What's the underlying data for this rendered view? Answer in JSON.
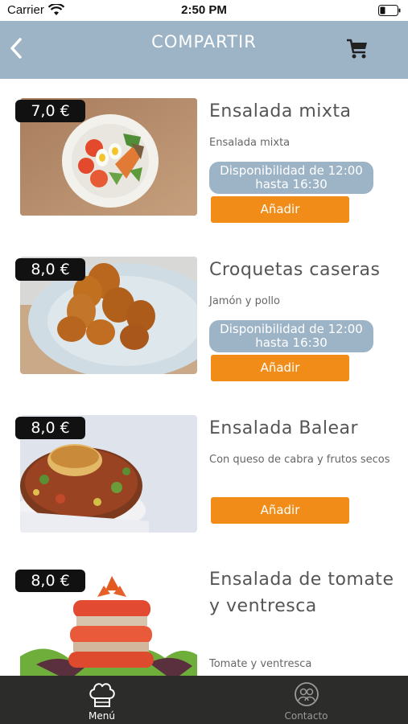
{
  "status_bar": {
    "carrier": "Carrier",
    "time": "2:50 PM"
  },
  "header": {
    "title": "COMPARTIR",
    "back_icon": "chevron-left-icon",
    "cart_icon": "shopping-cart-icon"
  },
  "colors": {
    "header": "#9db3c6",
    "accent": "#f28c18",
    "tabbar": "#2c2c2a",
    "price_badge": "#111111"
  },
  "items": [
    {
      "price": "7,0 €",
      "name": "Ensalada mixta",
      "description": "Ensalada mixta",
      "availability": "Disponibilidad de 12:00 hasta 16:30",
      "add_label": "Añadir"
    },
    {
      "price": "8,0 €",
      "name": "Croquetas caseras",
      "description": "Jamón y pollo",
      "availability": "Disponibilidad de 12:00 hasta 16:30",
      "add_label": "Añadir"
    },
    {
      "price": "8,0 €",
      "name": "Ensalada Balear",
      "description": "Con queso de cabra y frutos secos",
      "add_label": "Añadir"
    },
    {
      "price": "8,0 €",
      "name": "Ensalada de tomate y ventresca",
      "description": "Tomate y ventresca"
    }
  ],
  "tabs": [
    {
      "label": "Menú",
      "icon": "chef-hat-icon",
      "active": true
    },
    {
      "label": "Contacto",
      "icon": "contact-icon",
      "active": false
    }
  ]
}
